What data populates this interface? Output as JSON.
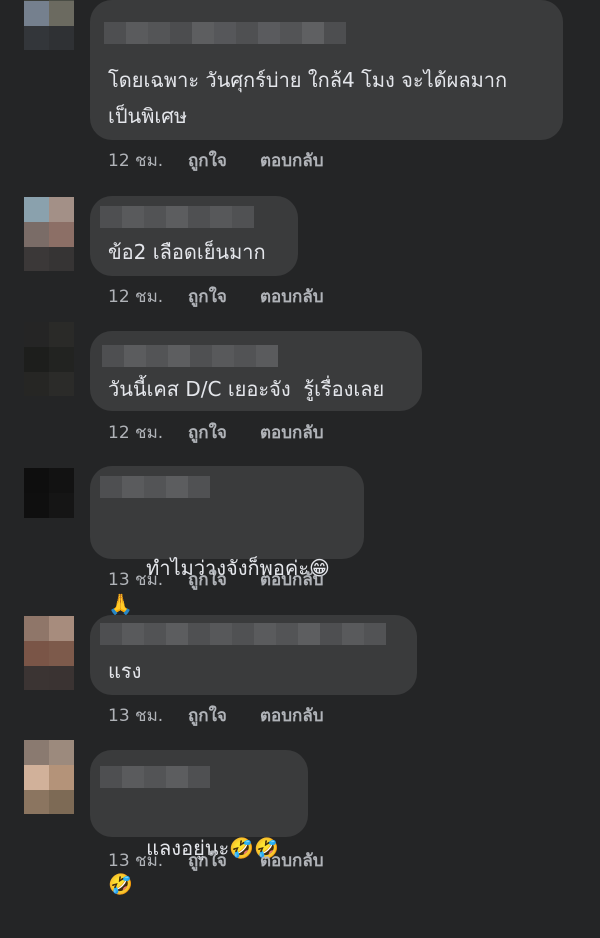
{
  "comments": [
    {
      "text": "โดยเฉพาะ วันศุกร์บ่าย ใกล้4 โมง จะได้ผลมาก\nเป็นพิเศษ",
      "time": "12 ชม.",
      "like": "ถูกใจ",
      "reply": "ตอบกลับ"
    },
    {
      "text": "ข้อ2 เลือดเย็นมาก",
      "time": "12 ชม.",
      "like": "ถูกใจ",
      "reply": "ตอบกลับ"
    },
    {
      "text": "วันนี้เคส D/C เยอะจัง  รู้เรื่องเลย",
      "time": "12 ชม.",
      "like": "ถูกใจ",
      "reply": "ตอบกลับ"
    },
    {
      "text": "ทำไมว่างจังก็พอค่ะ",
      "emoji": "😁🙏",
      "time": "13 ชม.",
      "like": "ถูกใจ",
      "reply": "ตอบกลับ"
    },
    {
      "text": "แรง",
      "time": "13 ชม.",
      "like": "ถูกใจ",
      "reply": "ตอบกลับ"
    },
    {
      "text": "แลงอยู่นะ",
      "emoji": "🤣🤣🤣",
      "time": "13 ชม.",
      "like": "ถูกใจ",
      "reply": "ตอบกลับ"
    }
  ]
}
